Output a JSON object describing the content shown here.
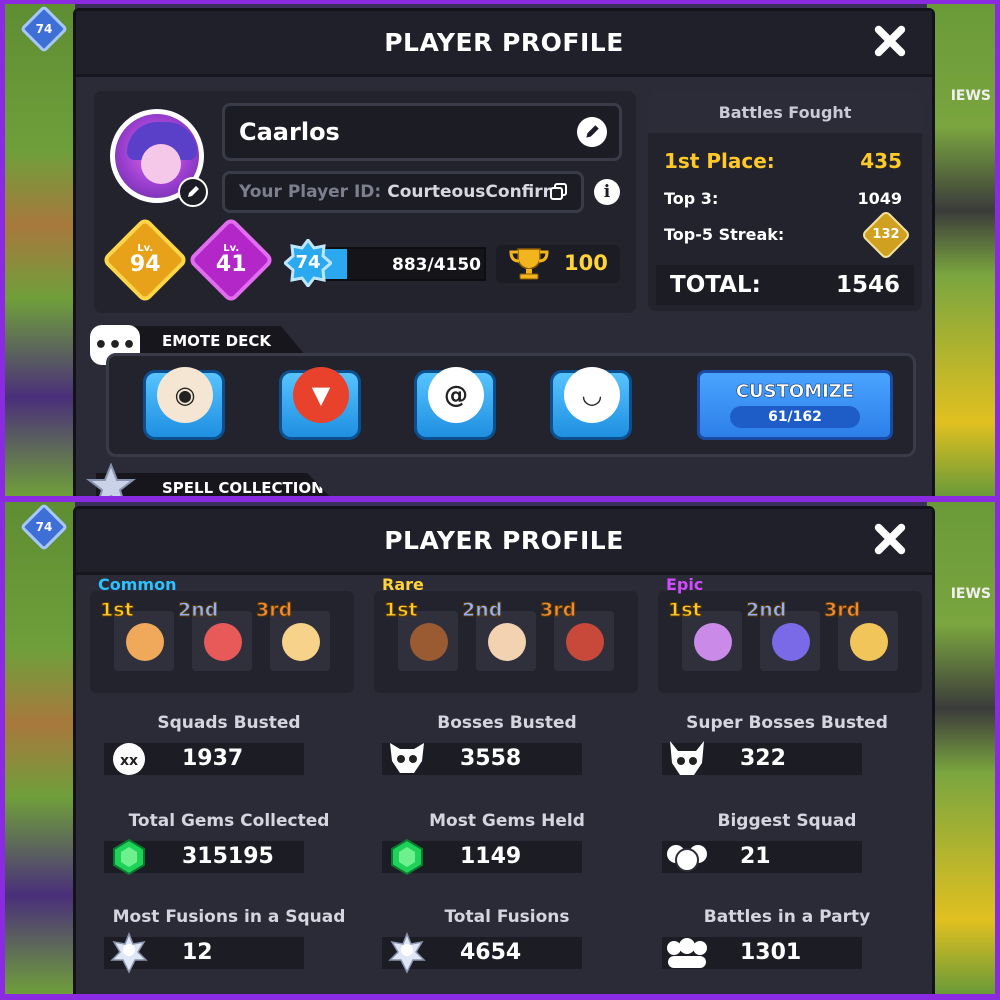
{
  "top": {
    "header_title": "PLAYER PROFILE",
    "bg_badge": "74",
    "bg_news": "IEWS",
    "profile": {
      "name": "Caarlos",
      "player_id_label": "Your Player ID:",
      "player_id_value": "CourteousConfirm",
      "level_gold_label": "Lv.",
      "level_gold": "94",
      "level_purple_label": "Lv.",
      "level_purple": "41",
      "xp_level": "74",
      "xp_text": "883/4150",
      "xp_progress": 0.213,
      "trophies": "100"
    },
    "battles": {
      "title": "Battles Fought",
      "first_label": "1st Place:",
      "first_value": "435",
      "top3_label": "Top 3:",
      "top3_value": "1049",
      "streak_label": "Top-5 Streak:",
      "streak_value": "132",
      "total_label": "TOTAL:",
      "total_value": "1546"
    },
    "emote_deck": {
      "title": "EMOTE DECK",
      "customize_label": "CUSTOMIZE",
      "customize_count": "61/162"
    },
    "spell_collection_title": "SPELL COLLECTION"
  },
  "bottom": {
    "header_title": "PLAYER PROFILE",
    "bg_badge": "74",
    "bg_news": "IEWS",
    "rarities": [
      {
        "title": "Common",
        "color": "#2fc1ff",
        "ranks": [
          "1st",
          "2nd",
          "3rd"
        ]
      },
      {
        "title": "Rare",
        "color": "#ffd43a",
        "ranks": [
          "1st",
          "2nd",
          "3rd"
        ]
      },
      {
        "title": "Epic",
        "color": "#d24bff",
        "ranks": [
          "1st",
          "2nd",
          "3rd"
        ]
      }
    ],
    "stats": [
      {
        "label": "Squads Busted",
        "value": "1937",
        "icon": "skull-ghost-icon"
      },
      {
        "label": "Bosses Busted",
        "value": "3558",
        "icon": "boss-skull-icon"
      },
      {
        "label": "Super Bosses Busted",
        "value": "322",
        "icon": "horned-skull-icon"
      },
      {
        "label": "Total Gems Collected",
        "value": "315195",
        "icon": "gem-icon"
      },
      {
        "label": "Most Gems Held",
        "value": "1149",
        "icon": "gem-icon"
      },
      {
        "label": "Biggest Squad",
        "value": "21",
        "icon": "squad-icon"
      },
      {
        "label": "Most Fusions in a Squad",
        "value": "12",
        "icon": "fusion-icon"
      },
      {
        "label": "Total Fusions",
        "value": "4654",
        "icon": "fusion-icon"
      },
      {
        "label": "Battles in a Party",
        "value": "1301",
        "icon": "party-icon"
      }
    ]
  }
}
